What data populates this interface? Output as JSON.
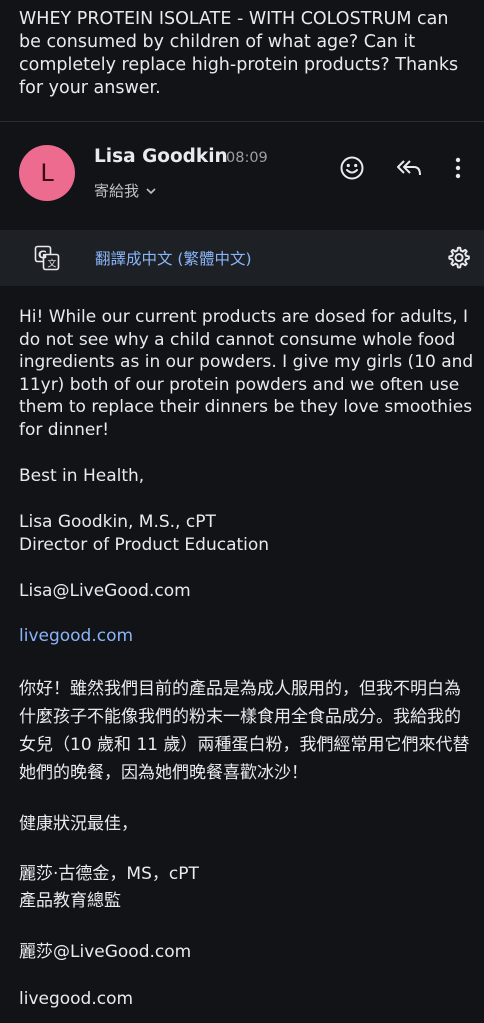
{
  "previous_message": {
    "text": "WHEY PROTEIN ISOLATE - WITH COLOSTRUM can be consumed by children of what age? Can it completely replace high-protein products? Thanks for your answer."
  },
  "message": {
    "avatar_letter": "L",
    "sender_name": "Lisa Goodkin",
    "time": "08:09",
    "recipient": "寄給我",
    "avatar_color": "#ec6b8f"
  },
  "translate": {
    "link": "翻譯成中文 (繁體中文)"
  },
  "body": {
    "paragraph1": "Hi! While our current products are dosed for adults, I do not see why a child cannot consume whole food ingredients as in our powders. I give my girls (10 and 11yr) both of our protein powders and we often use them to replace their dinners be they love smoothies for dinner!",
    "closing": "Best in Health,",
    "signature_name": "Lisa Goodkin, M.S., cPT",
    "signature_title": "Director of Product Education",
    "email": "Lisa@LiveGood.com",
    "website": "livegood.com",
    "zh_paragraph1": "你好！雖然我們目前的產品是為成人服用的，但我不明白為什麼孩子不能像我們的粉末一樣食用全食品成分。我給我的女兒（10 歲和 11 歲）兩種蛋白粉，我們經常用它們來代替她們的晚餐，因為她們晚餐喜歡冰沙！",
    "zh_closing": "健康狀況最佳，",
    "zh_signature_name": "麗莎·古德金，MS，cPT",
    "zh_signature_title": "產品教育總監",
    "zh_email": "麗莎@LiveGood.com",
    "zh_website": "livegood.com"
  },
  "colors": {
    "background": "#111317",
    "link": "#8ab4f8",
    "translate_bar": "#1d2125"
  }
}
